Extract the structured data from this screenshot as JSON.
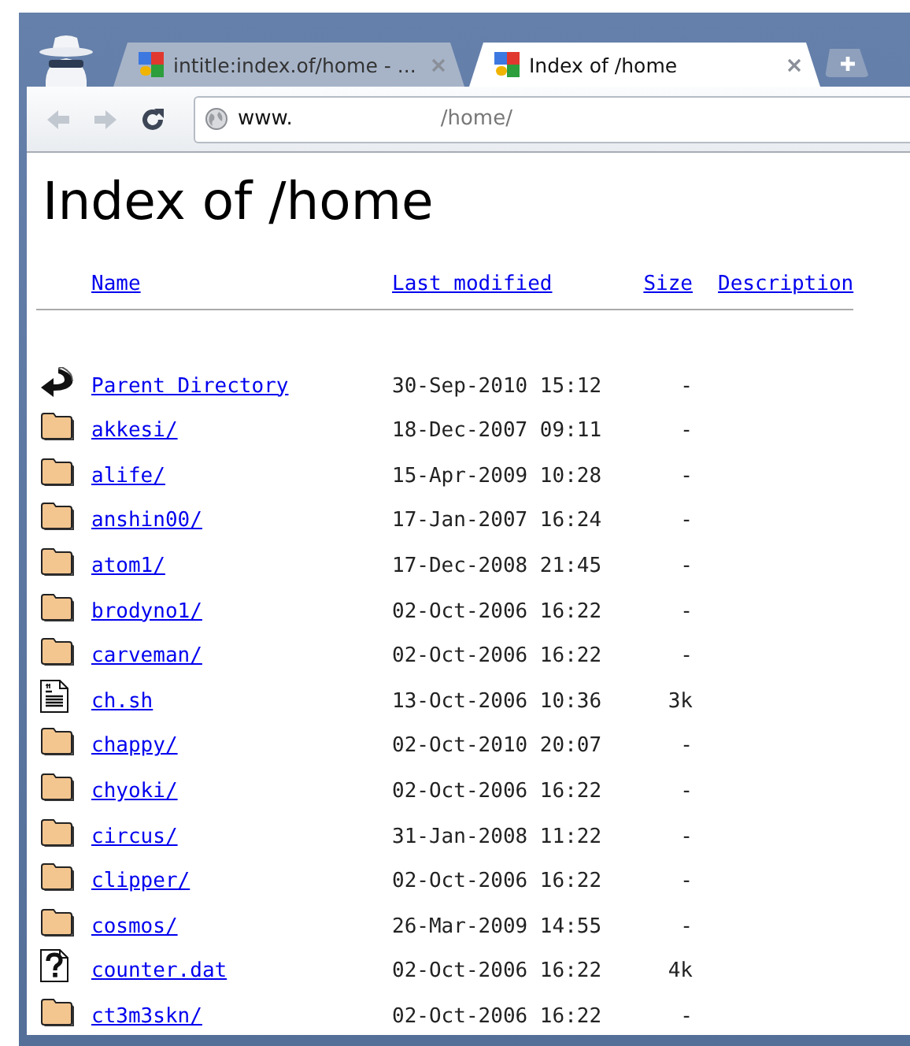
{
  "browser": {
    "tabs": [
      {
        "title": "intitle:index.of/home - ...",
        "selected": false
      },
      {
        "title": "Index of /home",
        "selected": true
      }
    ],
    "address": {
      "host": "www.",
      "path": "/home/"
    }
  },
  "page": {
    "heading": "Index of /home",
    "columns": [
      "Name",
      "Last modified",
      "Size",
      "Description"
    ],
    "rows": [
      {
        "kind": "parent",
        "name": "Parent Directory",
        "modified": "30-Sep-2010 15:12",
        "size": "-"
      },
      {
        "kind": "folder",
        "name": "akkesi/",
        "modified": "18-Dec-2007 09:11",
        "size": "-"
      },
      {
        "kind": "folder",
        "name": "alife/",
        "modified": "15-Apr-2009 10:28",
        "size": "-"
      },
      {
        "kind": "folder",
        "name": "anshin00/",
        "modified": "17-Jan-2007 16:24",
        "size": "-"
      },
      {
        "kind": "folder",
        "name": "atom1/",
        "modified": "17-Dec-2008 21:45",
        "size": "-"
      },
      {
        "kind": "folder",
        "name": "brodyno1/",
        "modified": "02-Oct-2006 16:22",
        "size": "-"
      },
      {
        "kind": "folder",
        "name": "carveman/",
        "modified": "02-Oct-2006 16:22",
        "size": "-"
      },
      {
        "kind": "text",
        "name": "ch.sh",
        "modified": "13-Oct-2006 10:36",
        "size": "3k"
      },
      {
        "kind": "folder",
        "name": "chappy/",
        "modified": "02-Oct-2010 20:07",
        "size": "-"
      },
      {
        "kind": "folder",
        "name": "chyoki/",
        "modified": "02-Oct-2006 16:22",
        "size": "-"
      },
      {
        "kind": "folder",
        "name": "circus/",
        "modified": "31-Jan-2008 11:22",
        "size": "-"
      },
      {
        "kind": "folder",
        "name": "clipper/",
        "modified": "02-Oct-2006 16:22",
        "size": "-"
      },
      {
        "kind": "folder",
        "name": "cosmos/",
        "modified": "26-Mar-2009 14:55",
        "size": "-"
      },
      {
        "kind": "unknown",
        "name": "counter.dat",
        "modified": "02-Oct-2006 16:22",
        "size": "4k"
      },
      {
        "kind": "folder",
        "name": "ct3m3skn/",
        "modified": "02-Oct-2006 16:22",
        "size": "-"
      }
    ]
  }
}
